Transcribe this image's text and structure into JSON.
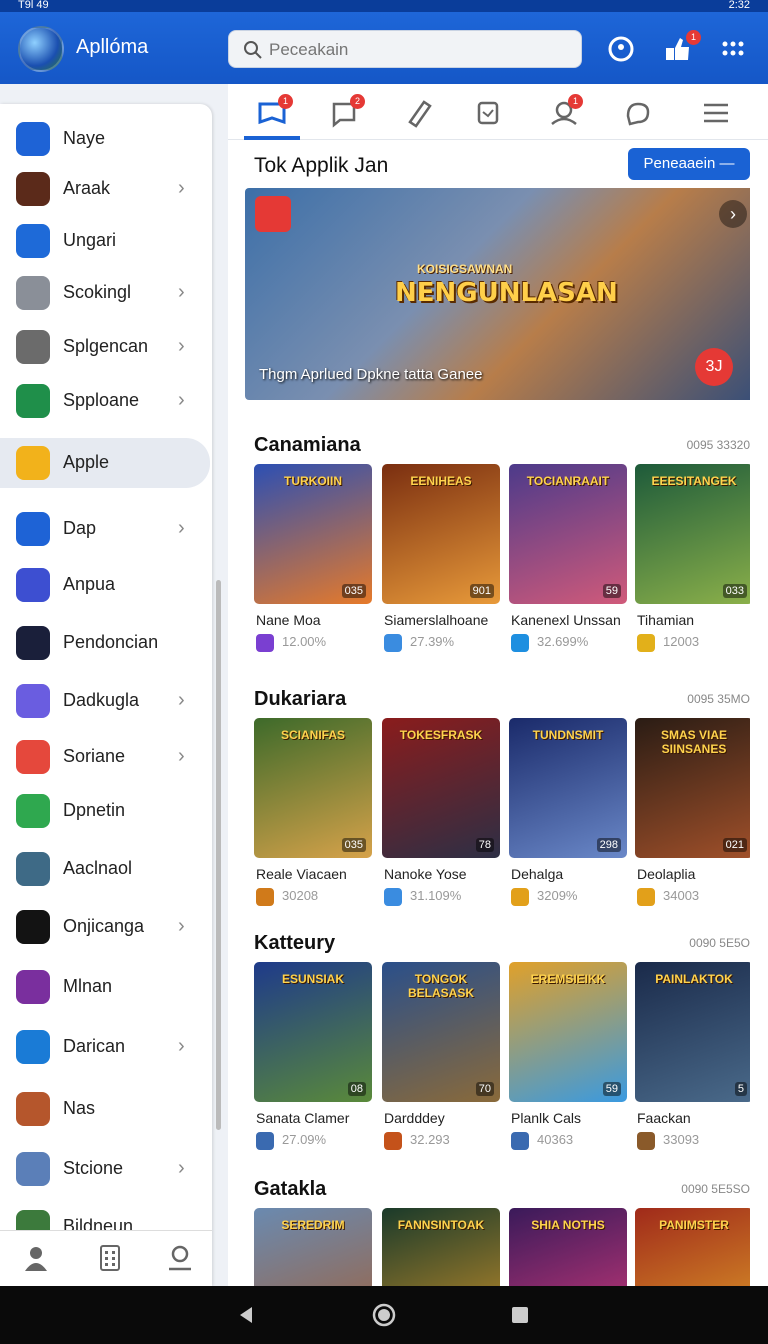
{
  "status": {
    "left": "T9l 49",
    "right": "2:32"
  },
  "app": {
    "title": "Apllóma",
    "search_placeholder": "Pecеakain"
  },
  "sidebar": {
    "items": [
      {
        "label": "Naye",
        "chevron": false,
        "color": "#1e63d6"
      },
      {
        "label": "Araak",
        "chevron": true,
        "color": "#5b2a1a"
      },
      {
        "label": "Ungari",
        "chevron": false,
        "color": "#1e6ad8"
      },
      {
        "label": "Scokingl",
        "chevron": true,
        "color": "#8a8f98"
      },
      {
        "label": "Splgencan",
        "chevron": true,
        "color": "#6b6b6b"
      },
      {
        "label": "Spplоane",
        "chevron": true,
        "color": "#1f8f4a"
      },
      {
        "label": "Apple",
        "chevron": false,
        "color": "#f2b21b"
      },
      {
        "label": "Dap",
        "chevron": true,
        "color": "#1e63d6"
      },
      {
        "label": "Anpua",
        "chevron": false,
        "color": "#3d4fd1"
      },
      {
        "label": "Pendoncian",
        "chevron": false,
        "color": "#1a1f3a"
      },
      {
        "label": "Dadkugla",
        "chevron": true,
        "color": "#6a5de0"
      },
      {
        "label": "Soriane",
        "chevron": true,
        "color": "#e5483c"
      },
      {
        "label": "Dpnetin",
        "chevron": false,
        "color": "#2fa84f"
      },
      {
        "label": "Aaclnaol",
        "chevron": false,
        "color": "#3e6a86"
      },
      {
        "label": "Onjicanga",
        "chevron": true,
        "color": "#131313"
      },
      {
        "label": "Mlnan",
        "chevron": false,
        "color": "#7a2f9e"
      },
      {
        "label": "Darican",
        "chevron": true,
        "color": "#1a7bd6"
      },
      {
        "label": "Nas",
        "chevron": false,
        "color": "#b5562c"
      },
      {
        "label": "Stcione",
        "chevron": true,
        "color": "#5b7fb8"
      },
      {
        "label": "Bildneun",
        "chevron": false,
        "color": "#3c7a3c"
      }
    ]
  },
  "main": {
    "header_title": "Tok Applik Jan",
    "header_button": "Peneaaein —",
    "hero": {
      "top": "KOISIGSAWNAN",
      "title": "NENGUNLASAN",
      "caption": "Thgm Aprlued Dpkne tatta Ganee",
      "count": "3J"
    },
    "sections": [
      {
        "title": "Canamiana",
        "more": "0095 33320",
        "cards": [
          {
            "name": "TURKOIIN",
            "num": "035",
            "title": "Nane Moa",
            "stat": "12.00%",
            "icol": "#7a3fd1",
            "c1": "#2c4fb3",
            "c2": "#e67a2a"
          },
          {
            "name": "EENIHEAS",
            "num": "901",
            "title": "Siamerslalhoane",
            "stat": "27.39%",
            "icol": "#3a8ce0",
            "c1": "#7a2e10",
            "c2": "#e89a3a"
          },
          {
            "name": "TOCIANRAAIT",
            "num": "59",
            "title": "Kanenexl Unssan",
            "stat": "32.699%",
            "icol": "#1e8fe0",
            "c1": "#4c3a8a",
            "c2": "#d05a7a"
          },
          {
            "name": "EEESITANGEK",
            "num": "033",
            "title": "Tihamian",
            "stat": "12003",
            "icol": "#e2b01a",
            "c1": "#1d5a3a",
            "c2": "#8bb04a"
          }
        ]
      },
      {
        "title": "Dukariara",
        "more": "0095 35MO",
        "cards": [
          {
            "name": "SCIANIFAS",
            "num": "035",
            "title": "Reale Viacaen",
            "stat": "30208",
            "icol": "#d07a1a",
            "c1": "#3d6a2a",
            "c2": "#d6a24a"
          },
          {
            "name": "TOKESFRASK",
            "num": "78",
            "title": "Nanoke Yose",
            "stat": "31.109%",
            "icol": "#3a8ce0",
            "c1": "#8a1c1c",
            "c2": "#2d2f45"
          },
          {
            "name": "TUNDNSMIT",
            "num": "298",
            "title": "Dehalga",
            "stat": "3209%",
            "icol": "#e2a01a",
            "c1": "#1a2a6a",
            "c2": "#6a88c8"
          },
          {
            "name": "SMAS VIAE SIINSANES",
            "num": "021",
            "title": "Deolaplia",
            "stat": "34003",
            "icol": "#e2a01a",
            "c1": "#2a1c14",
            "c2": "#a0502a"
          }
        ]
      },
      {
        "title": "Katteury",
        "more": "0090 5E5O",
        "cards": [
          {
            "name": "ESUNSIAK",
            "num": "08",
            "title": "Sanata Clamer",
            "stat": "27.09%",
            "icol": "#3a6ab0",
            "c1": "#1e3a8a",
            "c2": "#5a8a3a"
          },
          {
            "name": "TONGOK BELASASK",
            "num": "70",
            "title": "Dardddey",
            "stat": "32.293",
            "icol": "#c4521a",
            "c1": "#2a4f8a",
            "c2": "#8a6a3a"
          },
          {
            "name": "EREMSIEIKK",
            "num": "59",
            "title": "Planlk Cals",
            "stat": "40363",
            "icol": "#3a6ab0",
            "c1": "#e0a02a",
            "c2": "#3a9ae0"
          },
          {
            "name": "PAINLAKTOK",
            "num": "5",
            "title": "Faackan",
            "stat": "33093",
            "icol": "#8a5a2a",
            "c1": "#1a2a4a",
            "c2": "#4a6a8a"
          }
        ]
      },
      {
        "title": "Gatakla",
        "more": "0090 5E5SO",
        "cards": [
          {
            "name": "SEREDRIM",
            "num": "",
            "title": "",
            "stat": "",
            "icol": "#ffffff",
            "c1": "#6a8ab0",
            "c2": "#a0603a"
          },
          {
            "name": "FANNSINTOAK",
            "num": "",
            "title": "",
            "stat": "",
            "icol": "#ffffff",
            "c1": "#1a3a2a",
            "c2": "#c8902a"
          },
          {
            "name": "SHIA NOTHS",
            "num": "",
            "title": "",
            "stat": "",
            "icol": "#ffffff",
            "c1": "#3a1a5a",
            "c2": "#d03a7a"
          },
          {
            "name": "PANIMSTER",
            "num": "",
            "title": "",
            "stat": "",
            "icol": "#ffffff",
            "c1": "#a02a1a",
            "c2": "#e0a02a"
          }
        ]
      }
    ]
  }
}
